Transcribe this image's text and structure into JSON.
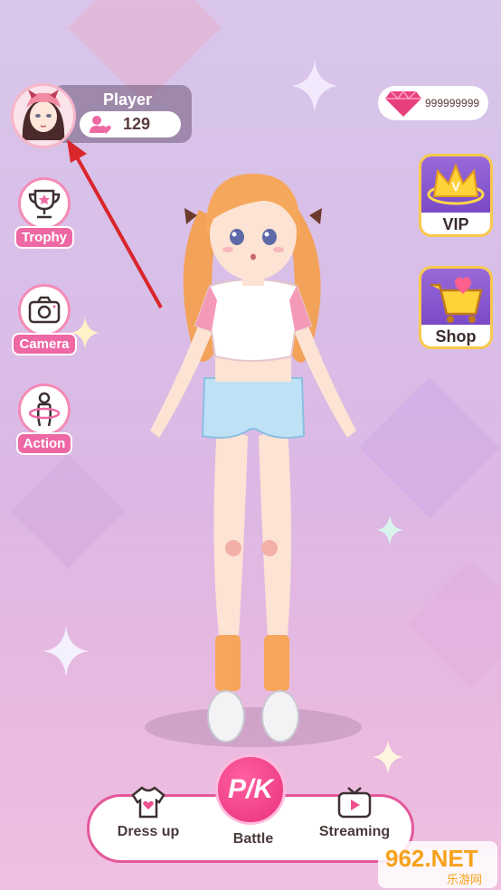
{
  "profile": {
    "name": "Player",
    "fans": "129"
  },
  "currency": {
    "gems": "999999999"
  },
  "left_menu": [
    {
      "label": "Trophy",
      "icon": "trophy-icon"
    },
    {
      "label": "Camera",
      "icon": "camera-icon"
    },
    {
      "label": "Action",
      "icon": "action-icon"
    }
  ],
  "right_menu": [
    {
      "label": "VIP",
      "icon": "crown-icon"
    },
    {
      "label": "Shop",
      "icon": "cart-icon"
    }
  ],
  "bottom_nav": [
    {
      "label": "Dress up",
      "icon": "shirt-icon"
    },
    {
      "label": "Battle",
      "icon": "pk-icon",
      "glyph": "P/K"
    },
    {
      "label": "Streaming",
      "icon": "tv-icon"
    }
  ],
  "watermark": {
    "main": "962.NET",
    "sub": "乐游网"
  },
  "colors": {
    "accent": "#e4589a",
    "gold": "#f7c94c",
    "purple": "#8a5ad0"
  }
}
